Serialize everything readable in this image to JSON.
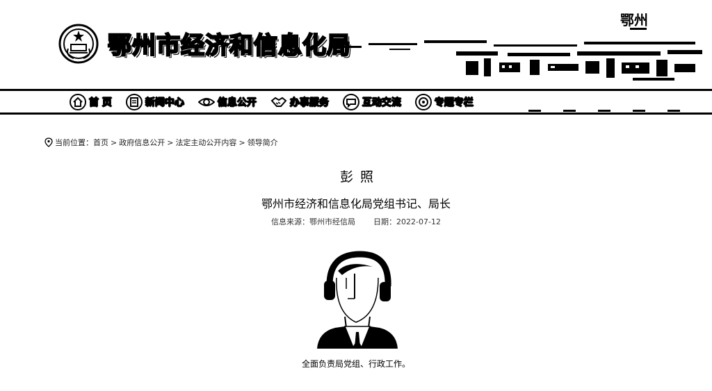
{
  "header": {
    "site_title": "鄂州市经济和信息化局",
    "city_logo_text": "鄂州"
  },
  "nav": {
    "items": [
      {
        "label": "首 页",
        "icon": "home-icon"
      },
      {
        "label": "新闻中心",
        "icon": "news-icon"
      },
      {
        "label": "信息公开",
        "icon": "eye-icon"
      },
      {
        "label": "办事服务",
        "icon": "handshake-icon"
      },
      {
        "label": "互动交流",
        "icon": "chat-icon"
      },
      {
        "label": "专题专栏",
        "icon": "target-icon"
      }
    ]
  },
  "breadcrumb": {
    "prefix": "当前位置：",
    "items": [
      "首页",
      "政府信息公开",
      "法定主动公开内容",
      "领导简介"
    ],
    "separator": ">"
  },
  "article": {
    "name": "彭照",
    "title": "鄂州市经济和信息化局党组书记、局长",
    "source_label": "信息来源：",
    "source": "鄂州市经信局",
    "date_label": "日期：",
    "date": "2022-07-12",
    "duties": "全面负责局党组、行政工作。"
  },
  "colors": {
    "text": "#000000",
    "background": "#ffffff"
  }
}
